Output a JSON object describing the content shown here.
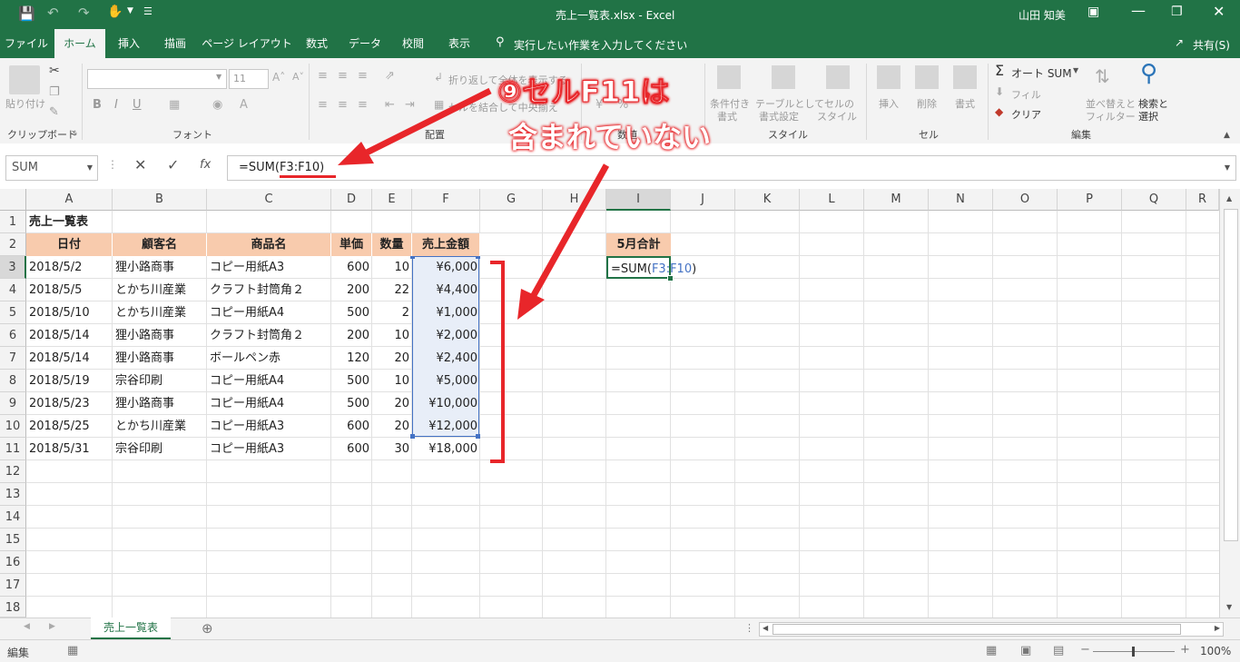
{
  "title_bar": {
    "title": "売上一覧表.xlsx  -  Excel",
    "user": "山田 知美",
    "save_icon": "save-icon",
    "undo_icon": "undo-icon",
    "redo_icon": "redo-icon",
    "touch_icon": "touch-mode-icon"
  },
  "tabs": [
    "ファイル",
    "ホーム",
    "挿入",
    "描画",
    "ページ レイアウト",
    "数式",
    "データ",
    "校閲",
    "表示"
  ],
  "tell_me": "実行したい作業を入力してください",
  "share": "共有(S)",
  "ribbon": {
    "clipboard": {
      "paste": "貼り付け",
      "label": "クリップボード"
    },
    "font": {
      "size": "11",
      "label": "フォント",
      "bold": "B",
      "italic": "I",
      "underline": "U"
    },
    "alignment": {
      "wrap": "折り返して全体を表示する",
      "merge": "セルを結合して中央揃え",
      "label": "配置"
    },
    "number": {
      "label": "数値",
      "percent": "%"
    },
    "styles": {
      "cond": "条件付き",
      "cond2": "書式",
      "table": "テーブルとして",
      "table2": "書式設定",
      "cell": "セルの",
      "cell2": "スタイル",
      "label": "スタイル"
    },
    "cells": {
      "insert": "挿入",
      "delete": "削除",
      "format": "書式",
      "label": "セル"
    },
    "editing": {
      "autosum": "オート SUM",
      "fill": "フィル",
      "clear": "クリア",
      "sort": "並べ替えと",
      "sort2": "フィルター",
      "find": "検索と",
      "find2": "選択",
      "label": "編集"
    }
  },
  "formula_bar": {
    "name_box": "SUM",
    "formula_prefix": "=SUM(",
    "formula_ref": "F3:F10",
    "formula_suffix": ")",
    "fx": "fx"
  },
  "annotation": {
    "line1": "⑨セルF11は",
    "line2": "含まれていない"
  },
  "columns": [
    "A",
    "B",
    "C",
    "D",
    "E",
    "F",
    "G",
    "H",
    "I",
    "J",
    "K",
    "L",
    "M",
    "N",
    "O",
    "P",
    "Q",
    "R"
  ],
  "rows": [
    "1",
    "2",
    "3",
    "4",
    "5",
    "6",
    "7",
    "8",
    "9",
    "10",
    "11",
    "12",
    "13",
    "14",
    "15",
    "16",
    "17",
    "18"
  ],
  "sheet": {
    "title": "売上一覧表",
    "headers": [
      "日付",
      "顧客名",
      "商品名",
      "単価",
      "数量",
      "売上金額"
    ],
    "data": [
      [
        "2018/5/2",
        "狸小路商事",
        "コピー用紙A3",
        "600",
        "10",
        "¥6,000"
      ],
      [
        "2018/5/5",
        "とかち川産業",
        "クラフト封筒角２",
        "200",
        "22",
        "¥4,400"
      ],
      [
        "2018/5/10",
        "とかち川産業",
        "コピー用紙A4",
        "500",
        "2",
        "¥1,000"
      ],
      [
        "2018/5/14",
        "狸小路商事",
        "クラフト封筒角２",
        "200",
        "10",
        "¥2,000"
      ],
      [
        "2018/5/14",
        "狸小路商事",
        "ボールペン赤",
        "120",
        "20",
        "¥2,400"
      ],
      [
        "2018/5/19",
        "宗谷印刷",
        "コピー用紙A4",
        "500",
        "10",
        "¥5,000"
      ],
      [
        "2018/5/23",
        "狸小路商事",
        "コピー用紙A4",
        "500",
        "20",
        "¥10,000"
      ],
      [
        "2018/5/25",
        "とかち川産業",
        "コピー用紙A3",
        "600",
        "20",
        "¥12,000"
      ],
      [
        "2018/5/31",
        "宗谷印刷",
        "コピー用紙A3",
        "600",
        "30",
        "¥18,000"
      ]
    ],
    "summary_label": "5月合計",
    "summary_formula_prefix": "=SUM(",
    "summary_formula_ref": "F3:F10",
    "summary_formula_suffix": ")"
  },
  "sheet_tab": "売上一覧表",
  "status": {
    "mode": "編集",
    "zoom": "100%"
  },
  "colors": {
    "excel_green": "#217346",
    "header_fill": "#f8cbad",
    "range_fill": "#e8eef8",
    "range_border": "#4472c4",
    "annotation_red": "#e8262a"
  }
}
